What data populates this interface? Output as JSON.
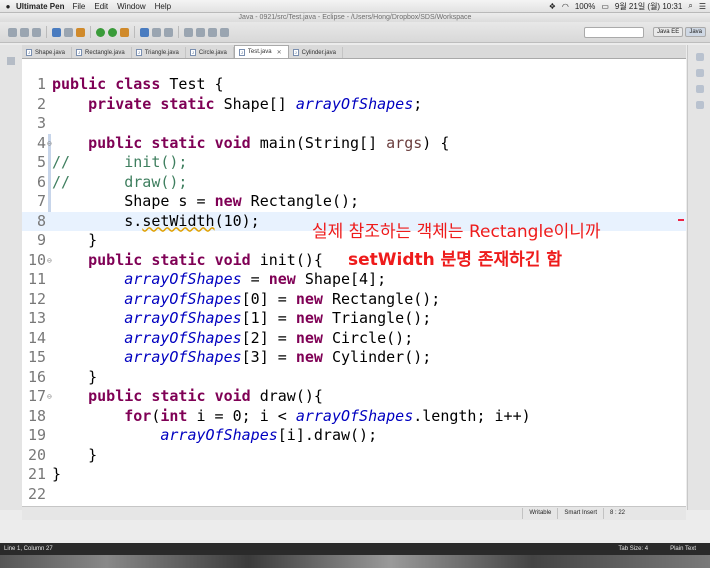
{
  "menubar": {
    "app_name": "Ultimate Pen",
    "menus": [
      "File",
      "Edit",
      "Window",
      "Help"
    ],
    "battery": "100%",
    "clock": "9월 21일 (월)  10:31"
  },
  "window": {
    "title": "Java - 0921/src/Test.java - Eclipse - /Users/Hong/Dropbox/SDS/Workspace"
  },
  "perspectives": [
    "Java EE",
    "Java"
  ],
  "tabs": [
    {
      "label": "Shape.java",
      "active": false
    },
    {
      "label": "Rectangle.java",
      "active": false
    },
    {
      "label": "Triangle.java",
      "active": false
    },
    {
      "label": "Circle.java",
      "active": false
    },
    {
      "label": "Test.java",
      "active": true
    },
    {
      "label": "Cylinder.java",
      "active": false
    }
  ],
  "code": {
    "current_line": 8,
    "lines": [
      "public class Test {",
      "    private static Shape[] arrayOfShapes;",
      "",
      "    public static void main(String[] args) {",
      "//      init();",
      "//      draw();",
      "        Shape s = new Rectangle();",
      "        s.setWidth(10);",
      "    }",
      "    public static void init(){",
      "        arrayOfShapes = new Shape[4];",
      "        arrayOfShapes[0] = new Rectangle();",
      "        arrayOfShapes[1] = new Triangle();",
      "        arrayOfShapes[2] = new Circle();",
      "        arrayOfShapes[3] = new Cylinder();",
      "    }",
      "    public static void draw(){",
      "        for(int i = 0; i < arrayOfShapes.length; i++)",
      "            arrayOfShapes[i].draw();",
      "    }",
      "}",
      ""
    ]
  },
  "annotation": {
    "line1": "실제 참조하는 객체는 Rectangle이니까",
    "line2": "setWidth 분명 존재하긴 함"
  },
  "status": {
    "writable": "Writable",
    "insert_mode": "Smart Insert",
    "position": "8 : 22"
  },
  "bottombar": {
    "cursor": "Line 1, Column 27",
    "tab_size": "Tab Size: 4",
    "mode": "Plain Text"
  },
  "colors": {
    "keyword": "#7f0055",
    "field": "#0000c0",
    "comment": "#3f7f5f",
    "annotation": "#ee1b1b",
    "current_line_bg": "#e8f2fe"
  }
}
